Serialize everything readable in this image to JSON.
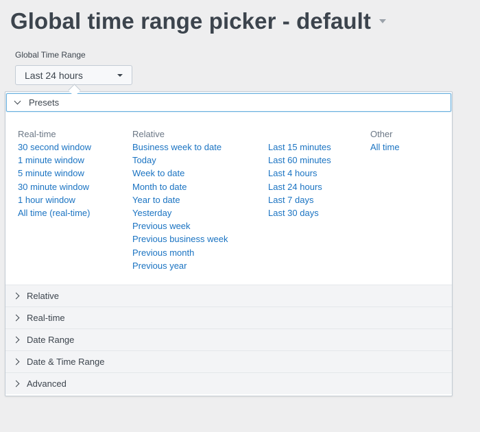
{
  "page_title": "Global time range picker - default",
  "input_label": "Global Time Range",
  "selected_range": "Last 24 hours",
  "presets_header": "Presets",
  "columns": {
    "realtime": {
      "heading": "Real-time",
      "items": [
        "30 second window",
        "1 minute window",
        "5 minute window",
        "30 minute window",
        "1 hour window",
        "All time (real-time)"
      ]
    },
    "relative": {
      "heading": "Relative",
      "items": [
        "Business week to date",
        "Today",
        "Week to date",
        "Month to date",
        "Year to date",
        "Yesterday",
        "Previous week",
        "Previous business week",
        "Previous month",
        "Previous year"
      ]
    },
    "last": {
      "items": [
        "Last 15 minutes",
        "Last 60 minutes",
        "Last 4 hours",
        "Last 24 hours",
        "Last 7 days",
        "Last 30 days"
      ]
    },
    "other": {
      "heading": "Other",
      "items": [
        "All time"
      ]
    }
  },
  "sections": [
    "Relative",
    "Real-time",
    "Date Range",
    "Date & Time Range",
    "Advanced"
  ],
  "colors": {
    "link": "#1a73c2",
    "text": "#3c444d",
    "muted": "#6b7785",
    "focus_border": "#6ab0de"
  }
}
